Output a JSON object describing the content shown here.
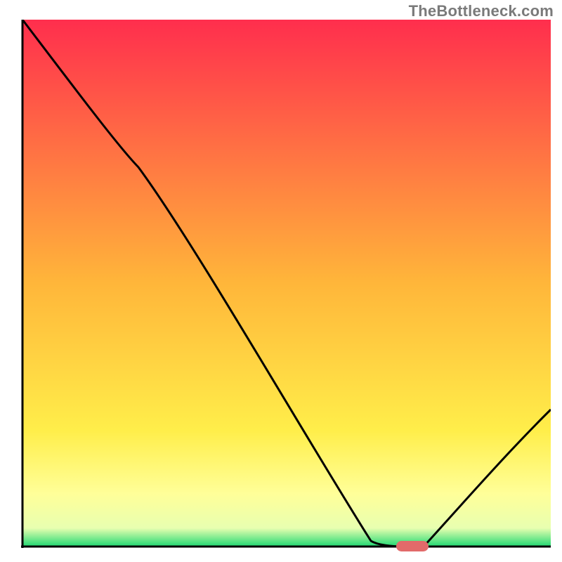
{
  "watermark": "TheBottleneck.com",
  "chart_data": {
    "type": "line",
    "title": "",
    "xlabel": "",
    "ylabel": "",
    "xlim": [
      0,
      100
    ],
    "ylim": [
      0,
      100
    ],
    "x": [
      0,
      22,
      66,
      72,
      76,
      100
    ],
    "values": [
      100,
      72,
      1,
      0,
      0,
      26
    ],
    "marker": {
      "x": 74,
      "y": 0,
      "color": "#e26a6a"
    },
    "gradient_stops": [
      {
        "offset": 0.0,
        "color": "#ff2e4d"
      },
      {
        "offset": 0.5,
        "color": "#ffb63a"
      },
      {
        "offset": 0.78,
        "color": "#ffee4a"
      },
      {
        "offset": 0.9,
        "color": "#ffff99"
      },
      {
        "offset": 0.965,
        "color": "#e8ffb0"
      },
      {
        "offset": 1.0,
        "color": "#1fd872"
      }
    ],
    "axis_color": "#000000",
    "curve_color": "#000000"
  }
}
